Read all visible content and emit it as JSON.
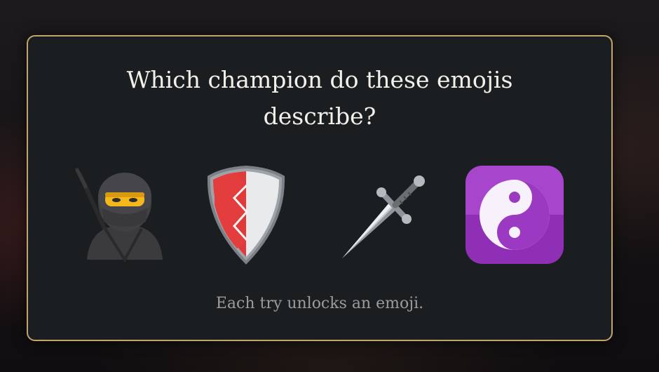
{
  "quiz": {
    "question": "Which champion do these emojis describe?",
    "hint": "Each try unlocks an emoji."
  },
  "emojis": [
    {
      "icon": "ninja-icon"
    },
    {
      "icon": "shield-icon"
    },
    {
      "icon": "dagger-icon"
    },
    {
      "icon": "yin-yang-icon"
    }
  ],
  "colors": {
    "panel_background": "#1b1e21",
    "panel_border": "#c2a56c",
    "question_text": "#f3f0ea",
    "hint_text": "#9c9c9c"
  }
}
